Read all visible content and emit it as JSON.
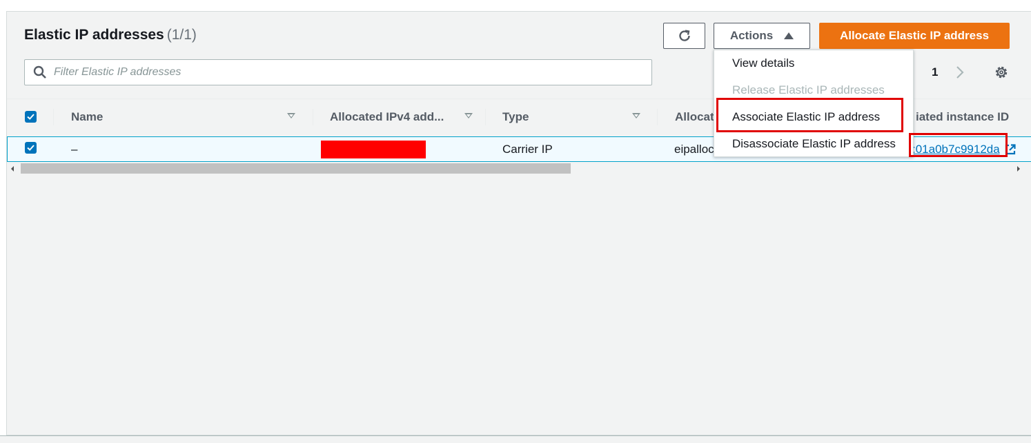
{
  "header": {
    "title": "Elastic IP addresses",
    "count": "(1/1)"
  },
  "toolbar": {
    "refresh_icon": "refresh-icon",
    "actions_label": "Actions",
    "allocate_label": "Allocate Elastic IP address"
  },
  "search": {
    "placeholder": "Filter Elastic IP addresses"
  },
  "pagination": {
    "current_page": "1"
  },
  "table": {
    "columns": [
      {
        "label": "Name"
      },
      {
        "label": "Allocated IPv4 add..."
      },
      {
        "label": "Type"
      },
      {
        "label": "Allocat"
      },
      {
        "label": "iated instance ID"
      }
    ],
    "rows": [
      {
        "selected": true,
        "name": "–",
        "type": "Carrier IP",
        "allocation_id": "eipalloc",
        "instance_id": ":01a0b7c9912da"
      }
    ]
  },
  "actions_menu": {
    "items": [
      {
        "label": "View details",
        "disabled": false
      },
      {
        "label": "Release Elastic IP addresses",
        "disabled": true
      },
      {
        "label": "Associate Elastic IP address",
        "disabled": false
      },
      {
        "label": "Disassociate Elastic IP address",
        "disabled": false
      }
    ]
  },
  "colors": {
    "primary": "#ec7211",
    "link": "#0073bb",
    "highlight": "#e00000"
  }
}
